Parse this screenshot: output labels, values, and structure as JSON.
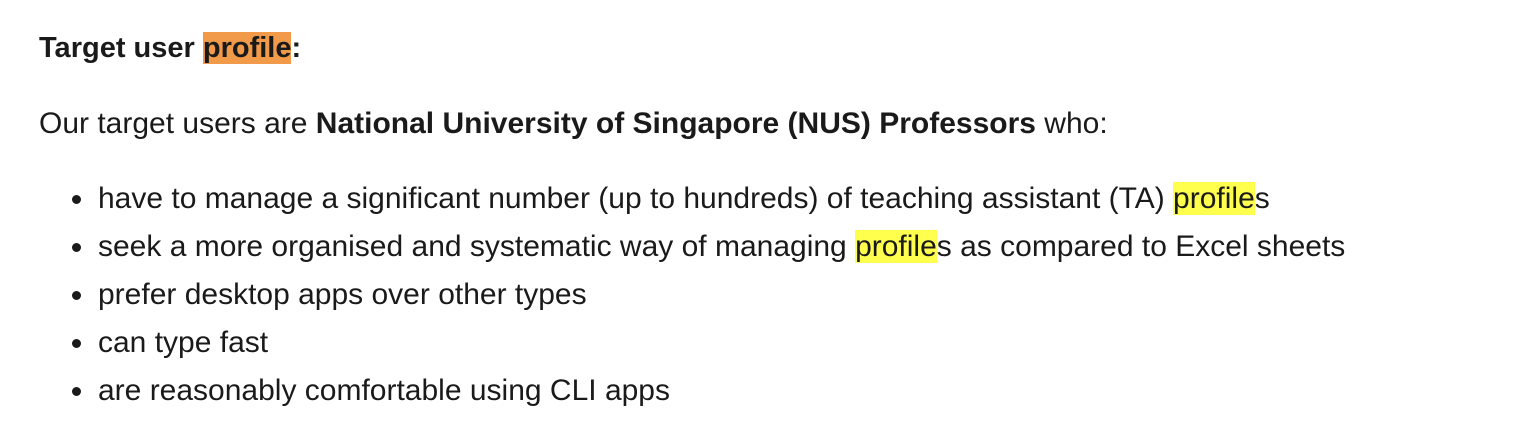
{
  "heading": {
    "prefix": "Target user ",
    "highlight": "profile",
    "suffix": ":"
  },
  "intro": {
    "prefix": "Our target users are ",
    "bold": "National University of Singapore (NUS) Professors",
    "suffix": " who:"
  },
  "items": [
    {
      "before": "have to manage a significant number (up to hundreds) of teaching assistant (TA) ",
      "match": "profile",
      "after": "s"
    },
    {
      "before": "seek a more organised and systematic way of managing ",
      "match": "profile",
      "after": "s as compared to Excel sheets"
    },
    {
      "text": "prefer desktop apps over other types"
    },
    {
      "text": "can type fast"
    },
    {
      "text": "are reasonably comfortable using CLI apps"
    }
  ],
  "colors": {
    "current_match": "#f09a4a",
    "other_match": "#ffff4d",
    "text": "#1a1a1a"
  }
}
